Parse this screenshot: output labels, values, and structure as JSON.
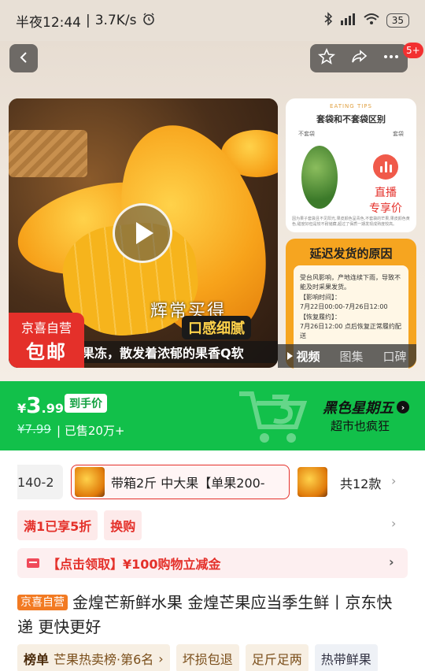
{
  "status_bar": {
    "time": "半夜12:44",
    "speed": "3.7K/s",
    "alarm_icon": "alarm-icon",
    "battery": "35"
  },
  "nav": {
    "back_icon": "chevron-left-icon",
    "star_icon": "star-icon",
    "share_icon": "share-icon",
    "more_icon": "more-icon",
    "more_badge": "5+"
  },
  "media": {
    "overlay_line1": "辉常买得",
    "overlay_line2": "口感细腻",
    "subtitle": "果冻，散发着浓郁的果香Q软",
    "badge_line1": "京喜自营",
    "badge_line2": "包邮",
    "side1_tips": "EATING TIPS",
    "side1_title": "套袋和不套袋区别",
    "side1_col_left": "不套袋",
    "side1_col_right": "套袋",
    "side1_fine": "因为果子套袋且不见阳光,果皮颜色呈青色,不套袋的芒果,果皮颜色黄色,甜度好但是较不耐储藏,超过了保质一期发现成熟度较高。",
    "live_line1": "直播",
    "live_line2": "专享价",
    "side2_title": "延迟发货的原因",
    "side2_body_1": "受台风影响，产地连续下雨，导致不能及时采果发货。",
    "side2_body_2": "【影响时间】：",
    "side2_body_3": "7月22日00:00-7月26日12:00",
    "side2_body_4": "【恢复履约】：",
    "side2_body_5": "7月26日12:00 点后恢复正常履约配送",
    "tabs": [
      "视频",
      "图集",
      "口碑"
    ]
  },
  "promo": {
    "currency": "¥",
    "price_int": "3",
    "price_dec": ".99",
    "hand_price": "到手价",
    "orig_price": "¥7.99",
    "sold": "| 已售20万+",
    "event_title": "黑色星期五",
    "event_sub": "超市也疯狂",
    "event_arrow_icon": "chevron-right-icon"
  },
  "sku": {
    "prev_cut": "140-2",
    "selected": "带箱2斤 中大果【单果200-",
    "count": "共12款"
  },
  "chips": [
    "满1已享5折",
    "换购"
  ],
  "coupon": {
    "text": "【点击领取】¥100购物立减金"
  },
  "product": {
    "tag": "京喜自营",
    "title": "金煌芒新鲜水果 金煌芒果应当季生鲜丨京东快递 更快更好"
  },
  "features": {
    "rank_label": "榜单",
    "rank_text": "芒果热卖榜·第6名",
    "f2": "坏损包退",
    "f3": "足斤足两",
    "f4": "热带鲜果"
  }
}
